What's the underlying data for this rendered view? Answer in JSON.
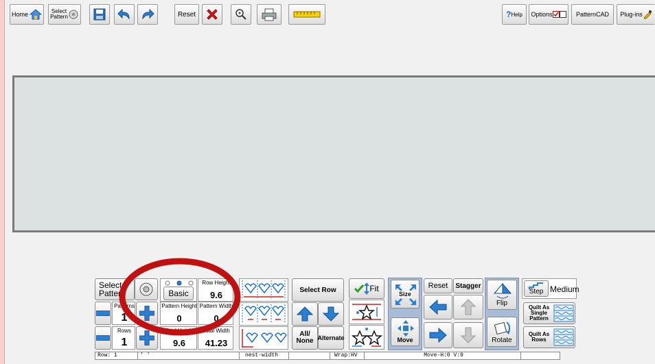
{
  "toolbar": {
    "home_label": "Home",
    "select_pattern_line1": "Select",
    "select_pattern_line2": "Pattern",
    "reset_label": "Reset",
    "help_label": "Help",
    "options_label": "Options",
    "patterncad_label": "PatternCAD",
    "plugins_label": "Plug-ins"
  },
  "bottom": {
    "select_pattern_label": "Select Pattern",
    "patterns_label": "Patterns",
    "patterns_value": "1",
    "rows_label": "Rows",
    "rows_value": "1",
    "mode_label": "Basic",
    "row_height_label": "Row Height",
    "row_height_value": "9.6",
    "pattern_height_label": "Pattern Height",
    "pattern_height_value": "0",
    "pattern_width_label": "Pattern Width",
    "pattern_width_value": "0",
    "total_height_label": "Total Height",
    "total_height_value": "9.6",
    "total_width_label": "Total Width",
    "total_width_value": "41.23",
    "select_row_label": "Select Row",
    "all_none_label": "All/ None",
    "alternate_label": "Alternate",
    "fit_label": "Fit",
    "size_label": "Size",
    "move_label": "Move",
    "reset_label": "Reset",
    "stagger_label": "Stagger",
    "flip_label": "Flip",
    "rotate_label": "Rotate",
    "step_label": "Step",
    "medium_label": "Medium",
    "quilt_single_label": "Quilt As Single Pattern",
    "quilt_rows_label": "Quilt As Rows"
  },
  "status": {
    "row": "Row: 1",
    "quote": "' '",
    "nest": "nest-width",
    "wrap": "Wrap:HV",
    "move": "Move-H:0 V:0"
  },
  "colors": {
    "annotation_circle": "#c01010",
    "arrow_blue": "#2a7fd4",
    "canvas": "#dde3e3"
  }
}
